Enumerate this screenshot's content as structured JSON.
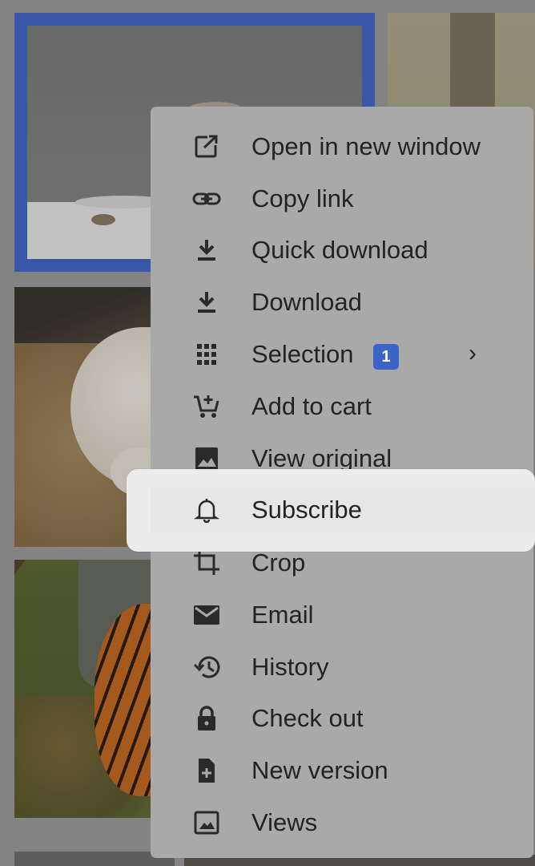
{
  "selection_color": "#4467c8",
  "thumbnails": [
    {
      "subject": "wall-snow-photo",
      "selected": true
    },
    {
      "subject": "grass-tree-photo",
      "selected": false
    },
    {
      "subject": "white-tiger-photo",
      "selected": false
    },
    {
      "subject": "tiger-grass-photo",
      "selected": false
    }
  ],
  "context_menu": {
    "items": [
      {
        "label": "Open in new window",
        "icon": "open-external-icon"
      },
      {
        "label": "Copy link",
        "icon": "link-icon"
      },
      {
        "label": "Quick download",
        "icon": "download-icon"
      },
      {
        "label": "Download",
        "icon": "download-icon"
      },
      {
        "label": "Selection",
        "icon": "grid-icon",
        "badge": "1",
        "submenu_arrow": "›"
      },
      {
        "label": "Add to cart",
        "icon": "cart-add-icon"
      },
      {
        "label": "View original",
        "icon": "image-icon"
      },
      {
        "label": "Subscribe",
        "icon": "bell-icon",
        "highlighted": true
      },
      {
        "label": "Crop",
        "icon": "crop-icon"
      },
      {
        "label": "Email",
        "icon": "mail-icon"
      },
      {
        "label": "History",
        "icon": "history-icon"
      },
      {
        "label": "Check out",
        "icon": "lock-icon"
      },
      {
        "label": "New version",
        "icon": "file-add-icon"
      },
      {
        "label": "Views",
        "icon": "image-frame-icon"
      }
    ],
    "badge_color": "#3c63c6"
  }
}
